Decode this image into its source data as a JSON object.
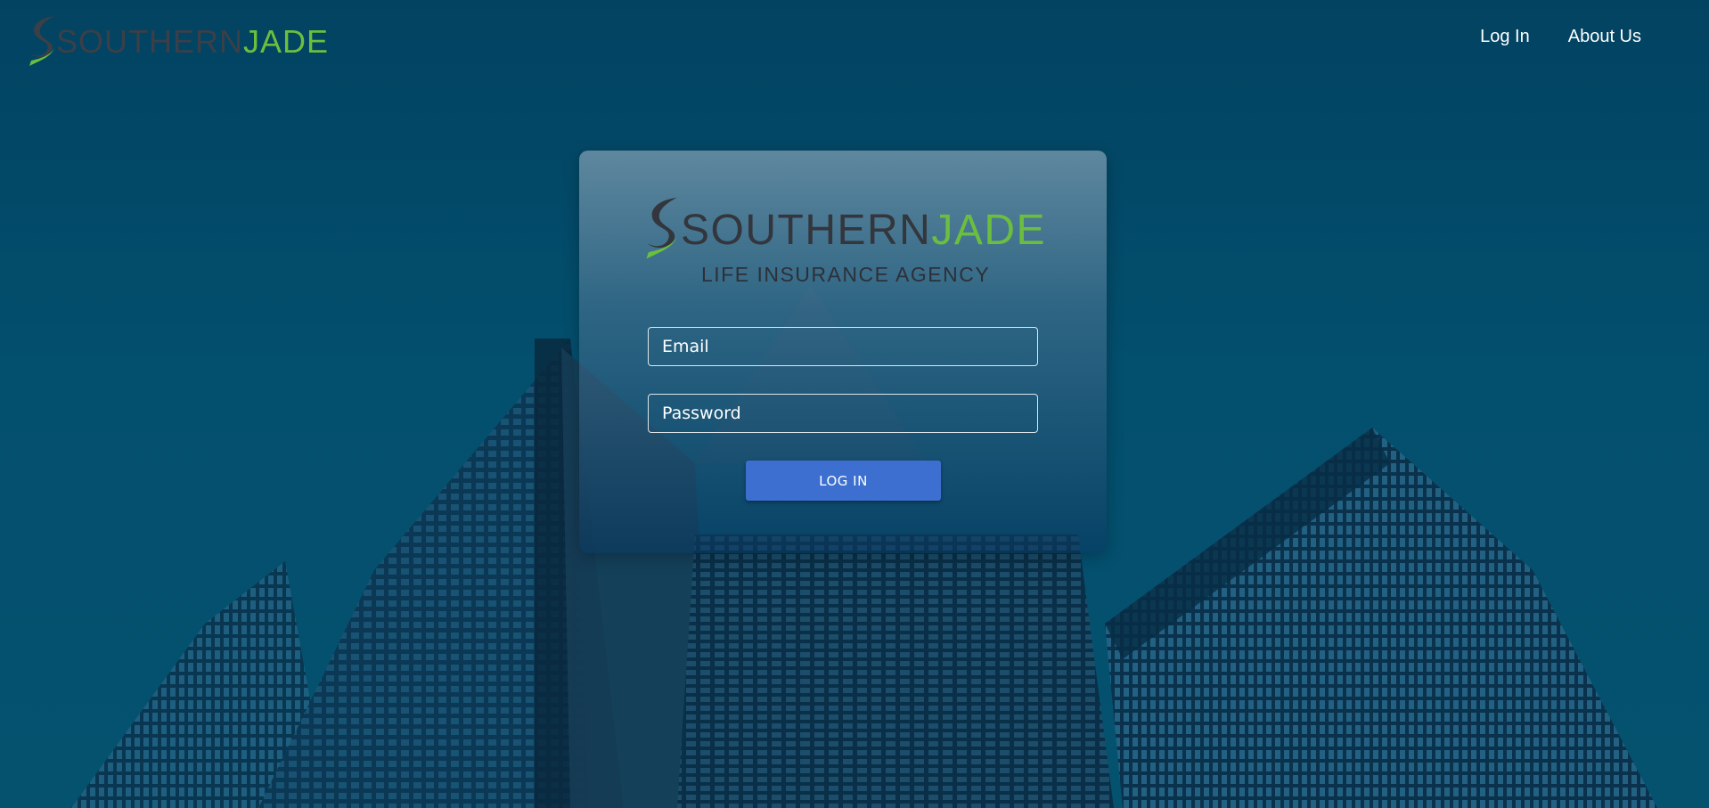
{
  "brand": {
    "part1": "SOUTHERN",
    "part2": "JADE",
    "mark_icon": "s-swoosh-logo-icon"
  },
  "nav": {
    "items": [
      {
        "label": "Log In"
      },
      {
        "label": "About Us"
      }
    ]
  },
  "login_card": {
    "logo": {
      "part1": "SOUTHERN",
      "part2": "JADE",
      "tagline": "LIFE INSURANCE AGENCY"
    },
    "email": {
      "placeholder": "Email",
      "value": ""
    },
    "password": {
      "placeholder": "Password",
      "value": ""
    },
    "submit_label": "LOG IN"
  },
  "colors": {
    "brand_dark": "#3b3f48",
    "brand_green": "#6cbf3e",
    "button_blue": "#3c6fd0",
    "background": "#03506e"
  },
  "background_image": "city-skyscrapers-photo"
}
